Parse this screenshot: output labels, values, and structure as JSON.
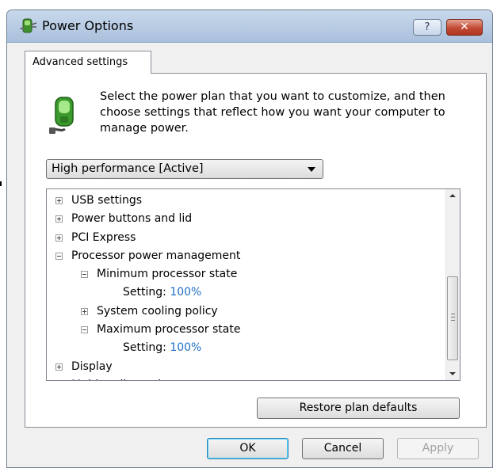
{
  "window": {
    "title": "Power Options",
    "help_label": "?",
    "close_label": "✕"
  },
  "tab": {
    "label": "Advanced settings"
  },
  "intro": {
    "text": "Select the power plan that you want to customize, and then choose settings that reflect how you want your computer to manage power."
  },
  "plan_select": {
    "value": "High performance [Active]"
  },
  "tree": {
    "rows": [
      {
        "label": "USB settings",
        "expander": "plus",
        "level": 0
      },
      {
        "label": "Power buttons and lid",
        "expander": "plus",
        "level": 0
      },
      {
        "label": "PCI Express",
        "expander": "plus",
        "level": 0
      },
      {
        "label": "Processor power management",
        "expander": "minus",
        "level": 0
      },
      {
        "label": "Minimum processor state",
        "expander": "minus",
        "level": 1
      },
      {
        "label": "Setting:",
        "value": "100%",
        "expander": "none",
        "level": 2
      },
      {
        "label": "System cooling policy",
        "expander": "plus",
        "level": 1
      },
      {
        "label": "Maximum processor state",
        "expander": "minus",
        "level": 1
      },
      {
        "label": "Setting:",
        "value": "100%",
        "expander": "none",
        "level": 2
      },
      {
        "label": "Display",
        "expander": "plus",
        "level": 0
      },
      {
        "label": "Multimedia settings",
        "expander": "plus",
        "level": 0
      }
    ]
  },
  "buttons": {
    "restore": "Restore plan defaults",
    "ok": "OK",
    "cancel": "Cancel",
    "apply": "Apply"
  },
  "colors": {
    "setting_value": "#1f6fc4",
    "titlebar": "#b9cde6",
    "close": "#c14a34"
  },
  "icons": {
    "title": "power-options-icon",
    "panel": "battery-plug-icon"
  }
}
